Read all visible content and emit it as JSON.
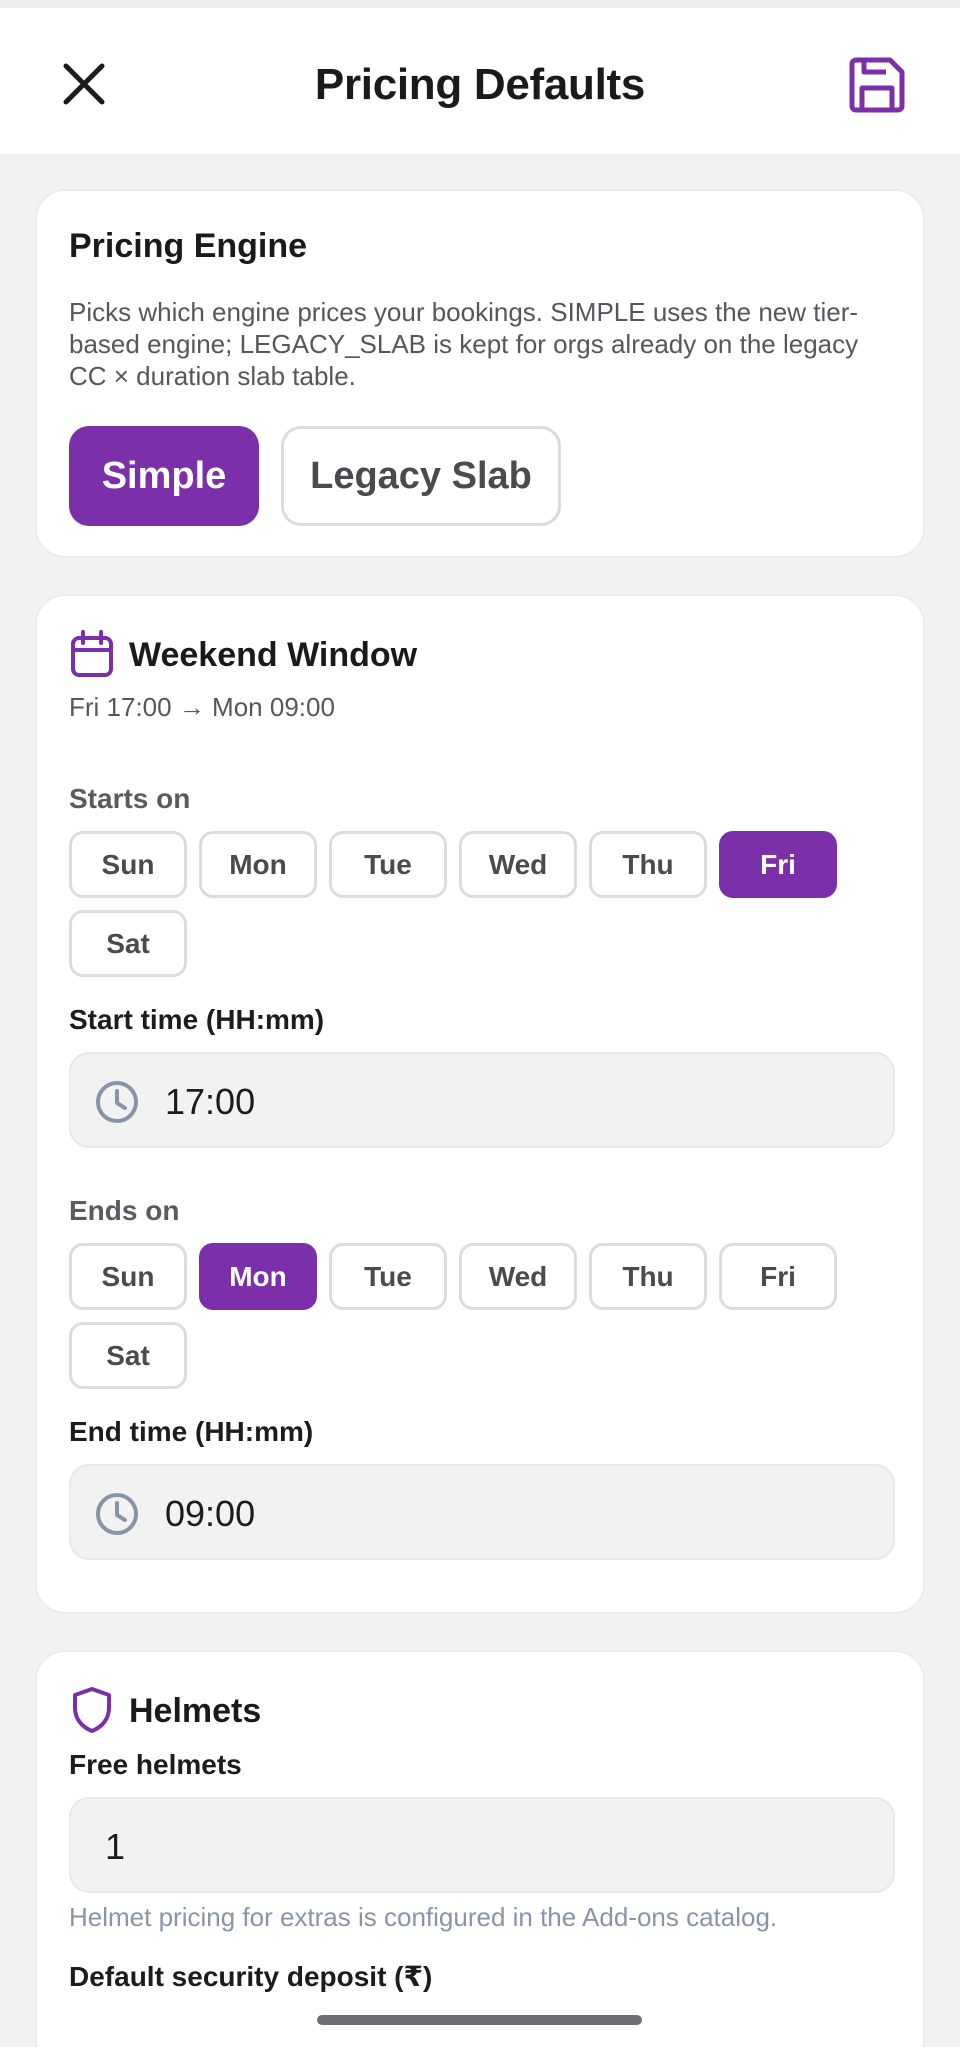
{
  "header": {
    "title": "Pricing Defaults",
    "close_icon": "close-icon",
    "save_icon": "save-icon"
  },
  "engine": {
    "title": "Pricing Engine",
    "description": "Picks which engine prices your bookings. SIMPLE uses the new tier-based engine; LEGACY_SLAB is kept for orgs already on the legacy CC × duration slab table.",
    "options": [
      "Simple",
      "Legacy Slab"
    ],
    "selected": "Simple"
  },
  "weekend": {
    "title": "Weekend Window",
    "summary": "Fri 17:00 → Mon 09:00",
    "starts_on_label": "Starts on",
    "ends_on_label": "Ends on",
    "days": [
      "Sun",
      "Mon",
      "Tue",
      "Wed",
      "Thu",
      "Fri",
      "Sat"
    ],
    "start_day": "Fri",
    "end_day": "Mon",
    "start_time_label": "Start time (HH:mm)",
    "start_time": "17:00",
    "end_time_label": "End time (HH:mm)",
    "end_time": "09:00"
  },
  "helmets": {
    "title": "Helmets",
    "free_label": "Free helmets",
    "free_value": "1",
    "hint": "Helmet pricing for extras is configured in the Add-ons catalog.",
    "deposit_label": "Default security deposit (₹)"
  },
  "colors": {
    "accent": "#7b2fa8",
    "background": "#f2f2f3",
    "hint": "#8a94a8"
  }
}
